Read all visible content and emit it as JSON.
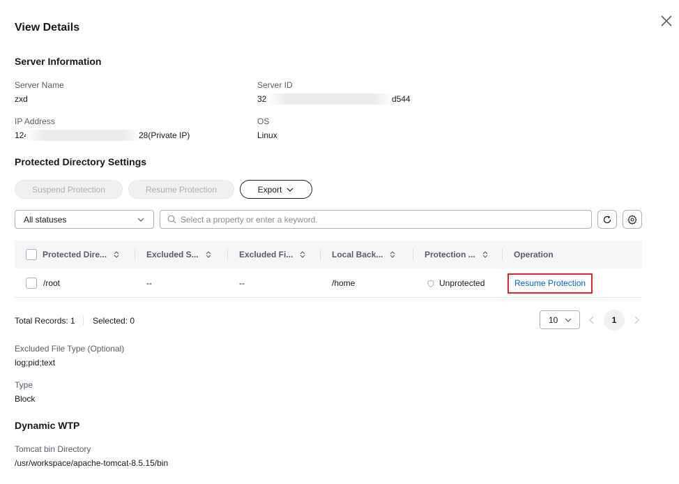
{
  "dialog": {
    "title": "View Details"
  },
  "server_info": {
    "heading": "Server Information",
    "server_name_label": "Server Name",
    "server_name": "zxd",
    "server_id_label": "Server ID",
    "server_id_prefix": "32",
    "server_id_suffix": "d544",
    "ip_label": "IP Address",
    "ip_prefix": "124",
    "ip_suffix": "28(Private IP)",
    "os_label": "OS",
    "os": "Linux"
  },
  "protected_dir": {
    "heading": "Protected Directory Settings",
    "suspend_label": "Suspend Protection",
    "resume_label": "Resume Protection",
    "export_label": "Export"
  },
  "filter": {
    "status_value": "All statuses",
    "search_placeholder": "Select a property or enter a keyword."
  },
  "table": {
    "columns": [
      "Protected Dire...",
      "Excluded S...",
      "Excluded Fi...",
      "Local Back...",
      "Protection ...",
      "Operation"
    ],
    "rows": [
      {
        "dir": "/root",
        "excluded_sub": "--",
        "excluded_file": "--",
        "local_backup": "/home",
        "status": "Unprotected",
        "operation": "Resume Protection"
      }
    ]
  },
  "footer": {
    "total_records": "Total Records: 1",
    "selected": "Selected: 0",
    "page_size": "10",
    "current_page": "1"
  },
  "details": {
    "excluded_type_label": "Excluded File Type (Optional)",
    "excluded_type": "log;pid;text",
    "type_label": "Type",
    "type": "Block"
  },
  "wtp": {
    "heading": "Dynamic WTP",
    "tomcat_label": "Tomcat bin Directory",
    "tomcat_value": "/usr/workspace/apache-tomcat-8.5.15/bin"
  },
  "colors": {
    "link": "#0062d3",
    "highlight": "#e0242f"
  }
}
